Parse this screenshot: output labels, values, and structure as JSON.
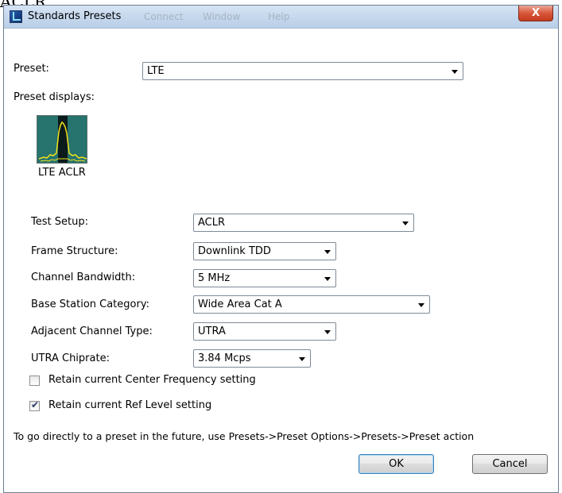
{
  "background_text": "ACLR",
  "window": {
    "title": "Standards Presets",
    "ghost_menu": [
      "Connect",
      "Window",
      "Help"
    ],
    "close_glyph": "X"
  },
  "preset": {
    "label": "Preset:",
    "value": "LTE"
  },
  "preset_displays": {
    "label": "Preset displays:",
    "tile_label": "LTE ACLR",
    "tile_icon": "spectrum-icon"
  },
  "fields": {
    "test_setup": {
      "label": "Test Setup:",
      "value": "ACLR"
    },
    "frame_structure": {
      "label": "Frame Structure:",
      "value": "Downlink TDD"
    },
    "channel_bandwidth": {
      "label": "Channel Bandwidth:",
      "value": "5 MHz"
    },
    "base_station_category": {
      "label": "Base Station Category:",
      "value": "Wide Area Cat A"
    },
    "adjacent_channel_type": {
      "label": "Adjacent Channel Type:",
      "value": "UTRA"
    },
    "utra_chiprate": {
      "label": "UTRA Chiprate:",
      "value": "3.84 Mcps"
    }
  },
  "checkboxes": {
    "retain_center": {
      "label": "Retain current Center Frequency setting",
      "checked": false
    },
    "retain_ref": {
      "label": "Retain current Ref Level setting",
      "checked": true
    }
  },
  "hint": "To go directly to a preset in the future, use Presets->Preset Options->Presets->Preset action",
  "buttons": {
    "ok": "OK",
    "cancel": "Cancel"
  },
  "colors": {
    "tile_bg": "#27736e",
    "trace": "#f2e21a",
    "titlebar": "#c3d6ec"
  }
}
